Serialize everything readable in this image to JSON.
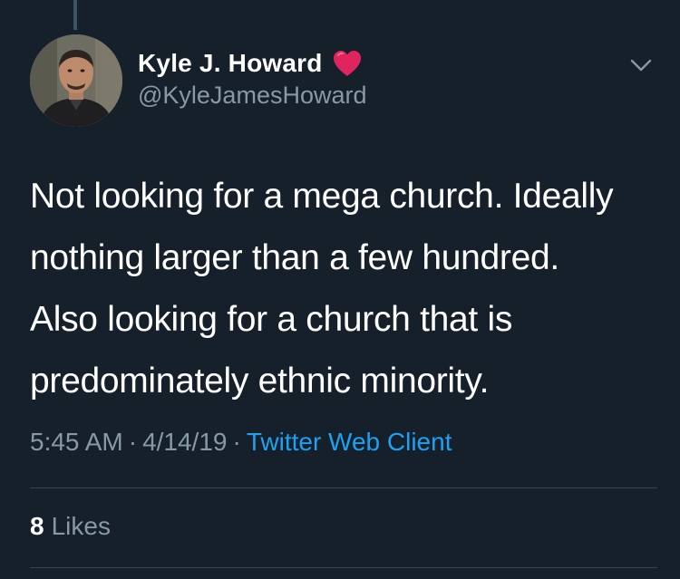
{
  "tweet": {
    "author": {
      "display_name": "Kyle J. Howard",
      "handle": "@KyleJamesHoward"
    },
    "text_lines": [
      "Not looking for a mega church. Ideally",
      "nothing larger than a few hundred.",
      "Also looking for a church that is",
      "predominately ethnic minority."
    ],
    "time": "5:45 AM",
    "date": "4/14/19",
    "separator": "·",
    "client": "Twitter Web Client",
    "likes_count": "8",
    "likes_label": "Likes"
  },
  "icons": {
    "heart": "heart-icon",
    "caret": "chevron-down-icon"
  },
  "colors": {
    "background": "#15202b",
    "secondary_text": "#8899a6",
    "link": "#1da1f2",
    "heart": "#e0245e",
    "divider": "#38444d"
  }
}
